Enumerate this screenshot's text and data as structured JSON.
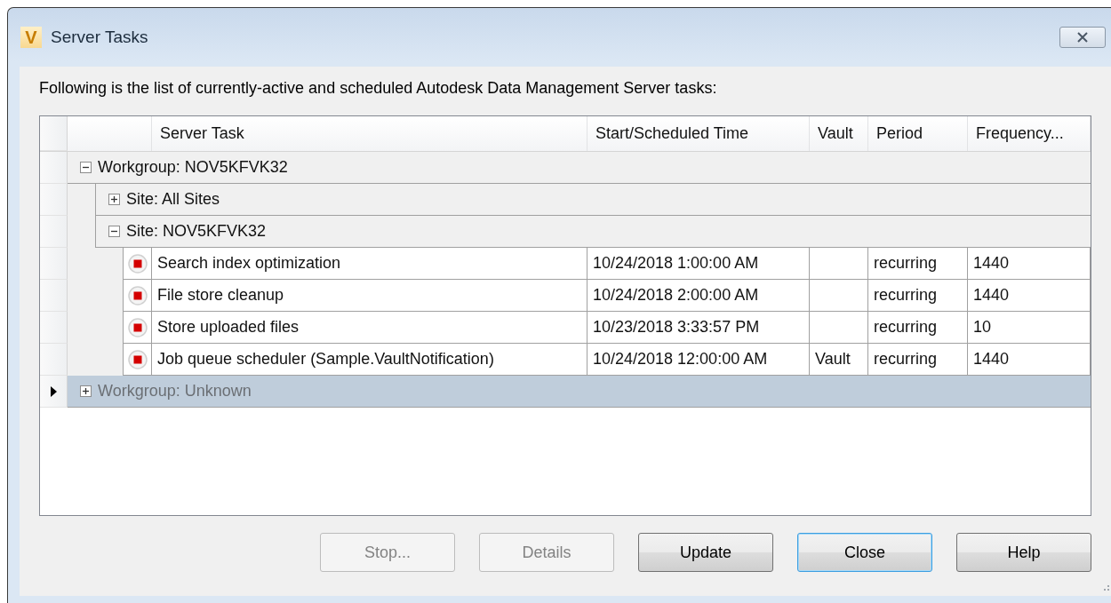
{
  "window": {
    "title": "Server Tasks",
    "logo_text": "V"
  },
  "description": "Following is the list of currently-active and scheduled Autodesk Data Management Server tasks:",
  "table": {
    "columns": [
      "Server Task",
      "Start/Scheduled Time",
      "Vault",
      "Period",
      "Frequency..."
    ],
    "rows": [
      {
        "kind": "group",
        "label": "Workgroup: NOV5KFVK32",
        "expanded": true,
        "selected": false,
        "children": [
          {
            "kind": "group",
            "label": "Site: All Sites",
            "expanded": false,
            "selected": false
          },
          {
            "kind": "group",
            "label": "Site: NOV5KFVK32",
            "expanded": true,
            "selected": false,
            "children": [
              {
                "kind": "task",
                "task": "Search index optimization",
                "time": "10/24/2018 1:00:00 AM",
                "period": "recurring",
                "frequency": "1440",
                "selected": false
              },
              {
                "kind": "task",
                "task": "File store cleanup",
                "time": "10/24/2018 2:00:00 AM",
                "period": "recurring",
                "frequency": "1440",
                "selected": false
              },
              {
                "kind": "task",
                "task": "Store uploaded files",
                "time": "10/23/2018 3:33:57 PM",
                "period": "recurring",
                "frequency": "10",
                "selected": false
              },
              {
                "kind": "task",
                "task": "Job queue scheduler (Sample.VaultNotification)",
                "time": "10/24/2018 12:00:00 AM",
                "vault": "Vault",
                "period": "recurring",
                "frequency": "1440",
                "selected": false
              }
            ]
          }
        ]
      },
      {
        "kind": "group",
        "label": "Workgroup: Unknown",
        "expanded": false,
        "selected": true
      }
    ]
  },
  "buttons": [
    {
      "label": "Stop...",
      "disabled": true,
      "default": false
    },
    {
      "label": "Details",
      "disabled": true,
      "default": false
    },
    {
      "label": "Update",
      "disabled": false,
      "default": false
    },
    {
      "label": "Close",
      "disabled": false,
      "default": true
    },
    {
      "label": "Help",
      "disabled": false,
      "default": false
    }
  ]
}
